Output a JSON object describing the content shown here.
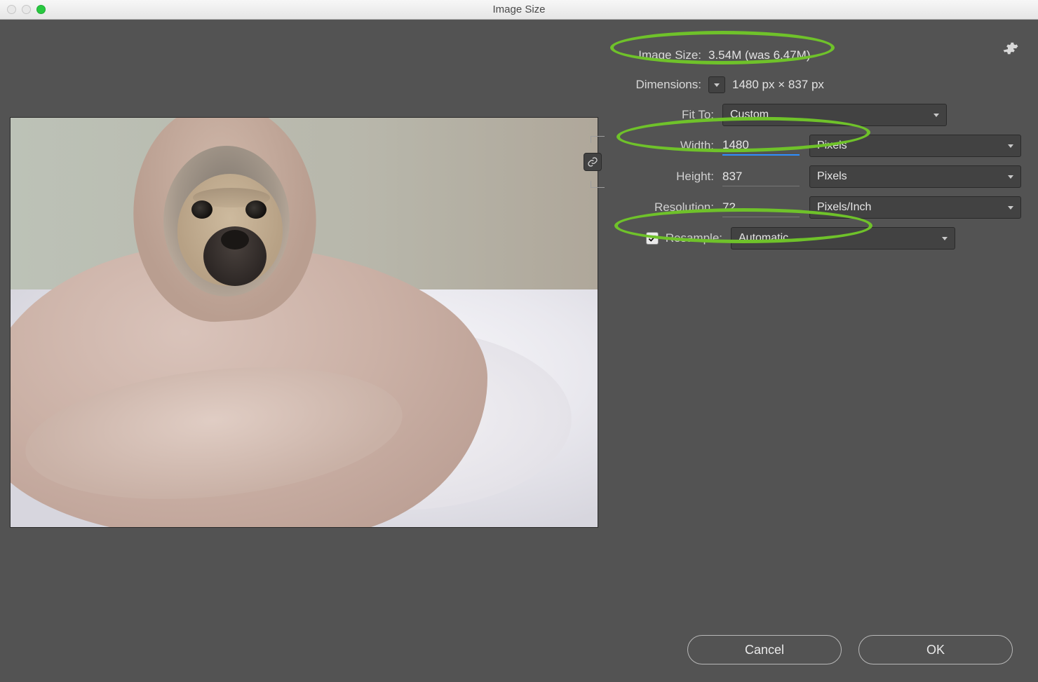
{
  "window": {
    "title": "Image Size"
  },
  "info": {
    "size_label": "Image Size:",
    "size_value": "3.54M (was 6.47M)",
    "dimensions_label": "Dimensions:",
    "dimensions_value": "1480 px  ×  837 px"
  },
  "fit": {
    "label": "Fit To:",
    "value": "Custom"
  },
  "width": {
    "label": "Width:",
    "value": "1480",
    "unit": "Pixels"
  },
  "height": {
    "label": "Height:",
    "value": "837",
    "unit": "Pixels"
  },
  "resolution": {
    "label": "Resolution:",
    "value": "72",
    "unit": "Pixels/Inch"
  },
  "resample": {
    "label": "Resample:",
    "checked": true,
    "value": "Automatic"
  },
  "buttons": {
    "cancel": "Cancel",
    "ok": "OK"
  }
}
